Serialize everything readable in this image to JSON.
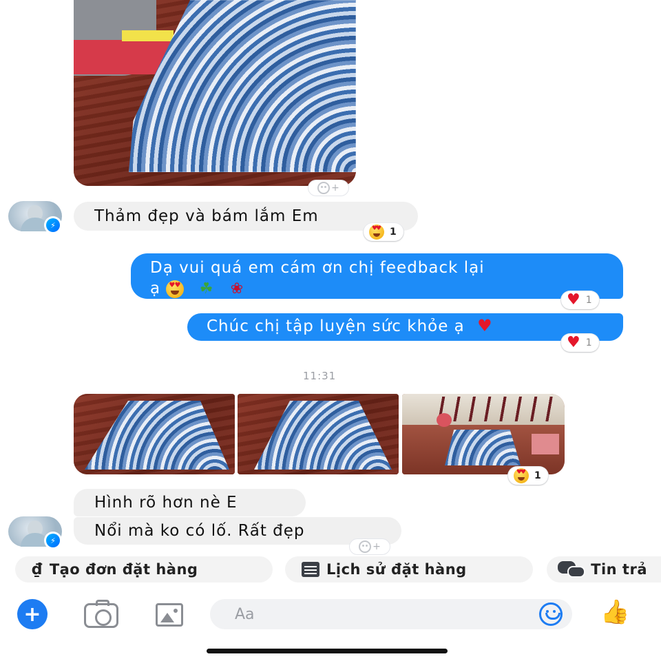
{
  "messages": {
    "incoming_1": {
      "text": "Thảm đẹp và bám lắm Em",
      "reaction_count": "1"
    },
    "outgoing_1": {
      "text_line1": "Dạ vui quá em cám ơn chị feedback lại",
      "text_line2_prefix": "ạ",
      "reaction_count": "1"
    },
    "outgoing_2": {
      "text": "Chúc chị tập luyện sức khỏe ạ",
      "reaction_count": "1"
    },
    "timestamp": "11:31",
    "photos_reaction_count": "1",
    "incoming_2": {
      "line1": "Hình rõ hơn nè E",
      "line2": "Nổi mà ko có lố. Rất đẹp"
    }
  },
  "quick_replies": [
    {
      "label": "Tạo đơn đặt hàng",
      "icon": "dong-currency-icon",
      "symbol": "₫"
    },
    {
      "label": "Lịch sử đặt hàng",
      "icon": "document-icon"
    },
    {
      "label": "Tin trả",
      "icon": "chat-bubbles-icon"
    }
  ],
  "composer": {
    "placeholder": "Aa"
  },
  "icons": {
    "add": "plus-icon",
    "camera": "camera-icon",
    "gallery": "gallery-icon",
    "emoji": "emoji-icon",
    "like": "thumbs-up-icon"
  },
  "colors": {
    "outgoing_bubble": "#1d8cf8",
    "incoming_bubble": "#f0f0f0",
    "accent": "#1d7cf2",
    "heart": "#e4172b"
  }
}
